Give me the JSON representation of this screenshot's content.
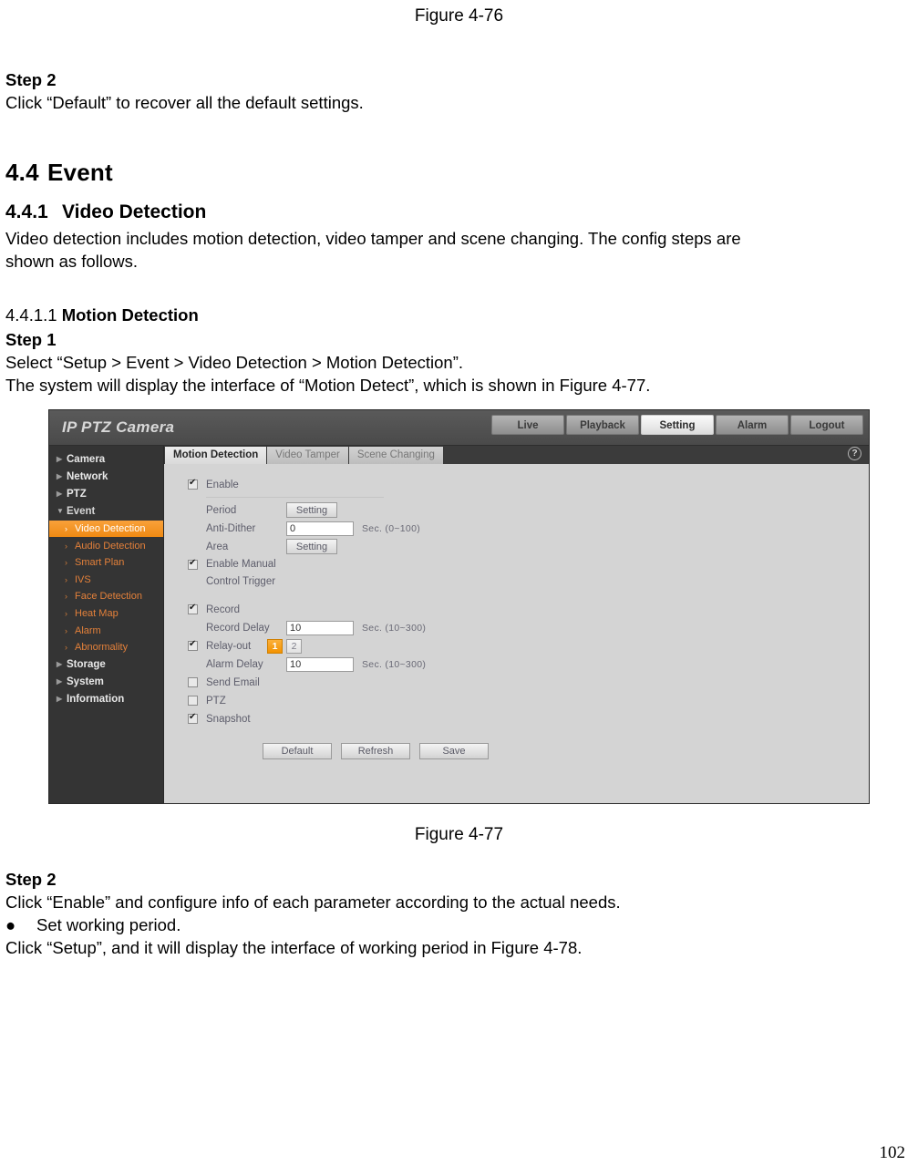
{
  "document": {
    "figure_top_caption": "Figure 4-76",
    "step2_top_heading": "Step 2",
    "step2_top_text": "Click “Default” to recover all the default settings.",
    "section_number": "4.4",
    "section_title": "Event",
    "subsection_number": "4.4.1",
    "subsection_title": "Video Detection",
    "subsection_body_line1": "Video detection includes motion detection, video tamper and scene changing. The config steps are",
    "subsection_body_line2": "shown as follows.",
    "subsubsection_number": "4.4.1.1",
    "subsubsection_title": "Motion Detection",
    "step1_heading": "Step 1",
    "step1_line1": "Select “Setup > Event > Video Detection > Motion Detection”.",
    "step1_line2": "The system will display the interface of “Motion Detect”, which is shown in Figure 4-77.",
    "figure_bottom_caption": "Figure 4-77",
    "step2_bottom_heading": "Step 2",
    "step2_bottom_line1": "Click “Enable” and configure info of each parameter according to the actual needs.",
    "bullet_marker": "●",
    "bullet_text": "Set working period.",
    "closing_line": "Click “Setup”, and it will display the interface of working period in Figure 4-78.",
    "page_number": "102"
  },
  "screenshot": {
    "brand": "IP PTZ Camera",
    "nav_buttons": [
      {
        "label": "Live",
        "active": false
      },
      {
        "label": "Playback",
        "active": false
      },
      {
        "label": "Setting",
        "active": true
      },
      {
        "label": "Alarm",
        "active": false
      },
      {
        "label": "Logout",
        "active": false
      }
    ],
    "sidebar": {
      "items": [
        {
          "label": "Camera",
          "type": "top",
          "expanded": false
        },
        {
          "label": "Network",
          "type": "top",
          "expanded": false
        },
        {
          "label": "PTZ",
          "type": "top",
          "expanded": false
        },
        {
          "label": "Event",
          "type": "top",
          "expanded": true
        },
        {
          "label": "Video Detection",
          "type": "sub",
          "selected": true
        },
        {
          "label": "Audio Detection",
          "type": "sub",
          "selected": false
        },
        {
          "label": "Smart Plan",
          "type": "sub",
          "selected": false
        },
        {
          "label": "IVS",
          "type": "sub",
          "selected": false
        },
        {
          "label": "Face Detection",
          "type": "sub",
          "selected": false
        },
        {
          "label": "Heat Map",
          "type": "sub",
          "selected": false
        },
        {
          "label": "Alarm",
          "type": "sub",
          "selected": false
        },
        {
          "label": "Abnormality",
          "type": "sub",
          "selected": false
        },
        {
          "label": "Storage",
          "type": "top",
          "expanded": false
        },
        {
          "label": "System",
          "type": "top",
          "expanded": false
        },
        {
          "label": "Information",
          "type": "top",
          "expanded": false
        }
      ],
      "collapsed_arrow": "▶",
      "expanded_arrow": "▼",
      "sub_chevron": "›"
    },
    "tabs": [
      {
        "label": "Motion Detection",
        "active": true
      },
      {
        "label": "Video Tamper",
        "active": false
      },
      {
        "label": "Scene Changing",
        "active": false
      }
    ],
    "help_icon_glyph": "?",
    "form": {
      "enable_label": "Enable",
      "enable_checked": true,
      "period_label": "Period",
      "period_button": "Setting",
      "antidither_label": "Anti-Dither",
      "antidither_value": "0",
      "antidither_unit": "Sec. (0~100)",
      "area_label": "Area",
      "area_button": "Setting",
      "manual_trigger_label_line1": "Enable Manual",
      "manual_trigger_label_line2": "Control Trigger",
      "manual_trigger_checked": true,
      "record_label": "Record",
      "record_checked": true,
      "record_delay_label": "Record Delay",
      "record_delay_value": "10",
      "record_delay_unit": "Sec. (10~300)",
      "relay_out_label": "Relay-out",
      "relay_out_checked": true,
      "relay_options": [
        {
          "label": "1",
          "on": true
        },
        {
          "label": "2",
          "on": false
        }
      ],
      "alarm_delay_label": "Alarm Delay",
      "alarm_delay_value": "10",
      "alarm_delay_unit": "Sec. (10~300)",
      "send_email_label": "Send Email",
      "send_email_checked": false,
      "ptz_label": "PTZ",
      "ptz_checked": false,
      "snapshot_label": "Snapshot",
      "snapshot_checked": true,
      "buttons": [
        {
          "label": "Default"
        },
        {
          "label": "Refresh"
        },
        {
          "label": "Save"
        }
      ]
    },
    "colors": {
      "accent_orange": "#f39200",
      "sidebar_bg": "#343434",
      "header_bg": "#4a4a4a",
      "content_bg": "#d4d4d4"
    }
  }
}
